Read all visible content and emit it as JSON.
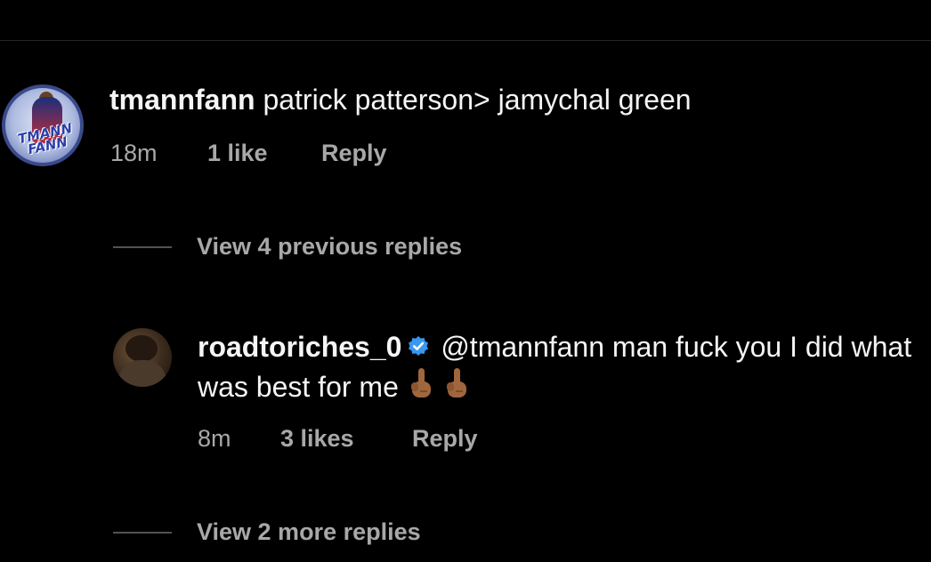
{
  "comments": [
    {
      "username": "tmannfann",
      "text": "patrick patterson> jamychal green",
      "time": "18m",
      "likes": "1 like",
      "reply_label": "Reply",
      "avatar_text": "TMANN FANN",
      "view_replies": "View 4 previous replies"
    }
  ],
  "reply": {
    "username": "roadtoriches_0",
    "verified": true,
    "text": "@tmannfann man fuck you I did what was best for me",
    "emojis": [
      "middle-finger-medium-dark-skin",
      "middle-finger-medium-dark-skin"
    ],
    "time": "8m",
    "likes": "3 likes",
    "reply_label": "Reply",
    "view_more": "View 2 more replies"
  },
  "colors": {
    "background": "#000000",
    "primary_text": "#f5f5f5",
    "secondary_text": "#a8a8a8",
    "verified_badge": "#3897f0",
    "divider": "#262626"
  }
}
